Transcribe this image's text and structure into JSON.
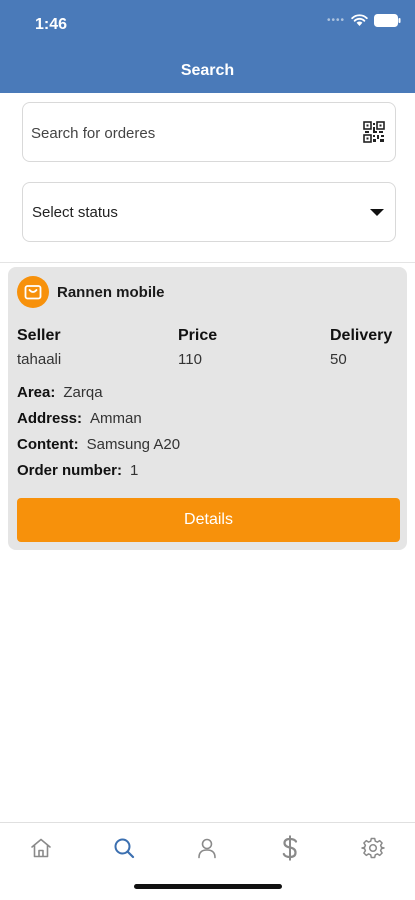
{
  "status_bar": {
    "time": "1:46"
  },
  "header": {
    "title": "Search"
  },
  "search": {
    "placeholder": "Search for orderes"
  },
  "status_select": {
    "label": "Select status"
  },
  "order": {
    "shop_name": "Rannen mobile",
    "seller_label": "Seller",
    "seller": "tahaali",
    "price_label": "Price",
    "price": "110",
    "delivery_label": "Delivery",
    "delivery": "50",
    "area_label": "Area:",
    "area": "Zarqa",
    "address_label": "Address:",
    "address": "Amman",
    "content_label": "Content:",
    "content": "Samsung A20",
    "order_number_label": "Order number:",
    "order_number": "1",
    "details_label": "Details"
  },
  "tabs": [
    {
      "icon": "home-icon",
      "active": false
    },
    {
      "icon": "search-icon",
      "active": true
    },
    {
      "icon": "user-icon",
      "active": false
    },
    {
      "icon": "dollar-icon",
      "active": false
    },
    {
      "icon": "gear-icon",
      "active": false
    }
  ],
  "colors": {
    "header": "#4a7ab9",
    "accent": "#f7910b",
    "tab_active": "#3b6fb0",
    "tab_inactive": "#8a8a8a"
  }
}
